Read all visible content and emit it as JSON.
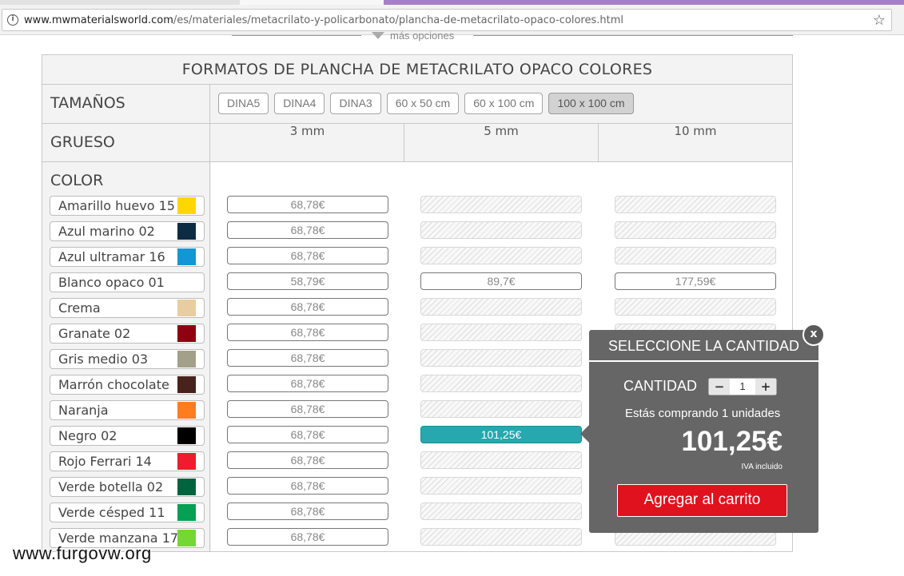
{
  "browser": {
    "url_host": "www.mwmaterialsworld.com",
    "url_path": "/es/materiales/metacrilato-y-policarbonato/plancha-de-metacrilato-opaco-colores.html"
  },
  "more_options": "más opciones",
  "table": {
    "title": "FORMATOS DE PLANCHA DE METACRILATO OPACO COLORES",
    "sizes_label": "TAMAÑOS",
    "sizes": [
      "DINA5",
      "DINA4",
      "DINA3",
      "60 x 50 cm",
      "60 x 100 cm",
      "100 x 100 cm"
    ],
    "selected_size": "100 x 100 cm",
    "thickness_label": "GRUESO",
    "thickness": [
      "3 mm",
      "5 mm",
      "10 mm"
    ],
    "color_label": "COLOR",
    "colors": [
      {
        "name": "Amarillo huevo 15",
        "swatch": "#ffd700",
        "prices": [
          "68,78€",
          "",
          ""
        ]
      },
      {
        "name": "Azul marino 02",
        "swatch": "#0c2c44",
        "prices": [
          "68,78€",
          "",
          ""
        ]
      },
      {
        "name": "Azul ultramar 16",
        "swatch": "#1297d4",
        "prices": [
          "68,78€",
          "",
          ""
        ]
      },
      {
        "name": "Blanco opaco 01",
        "swatch": "#ffffff",
        "prices": [
          "58,79€",
          "89,7€",
          "177,59€"
        ]
      },
      {
        "name": "Crema",
        "swatch": "#e8cda0",
        "prices": [
          "68,78€",
          "",
          ""
        ]
      },
      {
        "name": "Granate 02",
        "swatch": "#8f0010",
        "prices": [
          "68,78€",
          "",
          ""
        ]
      },
      {
        "name": "Gris medio 03",
        "swatch": "#a3a08a",
        "prices": [
          "68,78€",
          "",
          ""
        ]
      },
      {
        "name": "Marrón chocolate",
        "swatch": "#48231e",
        "prices": [
          "68,78€",
          "",
          ""
        ]
      },
      {
        "name": "Naranja",
        "swatch": "#ff7c1f",
        "prices": [
          "68,78€",
          "",
          ""
        ]
      },
      {
        "name": "Negro 02",
        "swatch": "#000000",
        "prices": [
          "68,78€",
          "101,25€",
          ""
        ]
      },
      {
        "name": "Rojo Ferrari 14",
        "swatch": "#ee1c2d",
        "prices": [
          "68,78€",
          "",
          ""
        ]
      },
      {
        "name": "Verde botella 02",
        "swatch": "#02633f",
        "prices": [
          "68,78€",
          "",
          ""
        ]
      },
      {
        "name": "Verde césped 11",
        "swatch": "#05a053",
        "prices": [
          "68,78€",
          "",
          ""
        ]
      },
      {
        "name": "Verde manzana 17",
        "swatch": "#75d733",
        "prices": [
          "68,78€",
          "",
          ""
        ]
      }
    ]
  },
  "popup": {
    "title": "SELECCIONE LA CANTIDAD",
    "close": "x",
    "quantity_label": "CANTIDAD",
    "minus": "−",
    "plus": "+",
    "quantity": "1",
    "buying_text": "Estás comprando 1 unidades",
    "price": "101,25€",
    "tax_note": "IVA incluido",
    "cart_button": "Agregar al carrito"
  },
  "watermark": "www.furgovw.org",
  "colors": {
    "selected_price": "#27a7ae",
    "cart_button": "#e0121e",
    "popup_bg": "#666666"
  }
}
